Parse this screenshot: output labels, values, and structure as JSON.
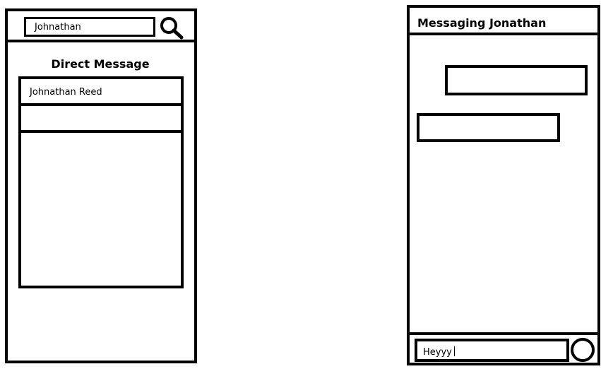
{
  "search": {
    "value": "Johnathan"
  },
  "direct_message": {
    "title": "Direct Message",
    "results": [
      {
        "label": "Johnathan Reed"
      },
      {
        "label": ""
      }
    ]
  },
  "chat": {
    "title": "Messaging Jonathan",
    "messages": [
      {
        "text": ""
      },
      {
        "text": ""
      }
    ],
    "compose_value": "Heyyy"
  },
  "icons": {
    "search": "search-icon",
    "send": "send-icon"
  },
  "colors": {
    "outline": "#000000",
    "background": "#ffffff"
  }
}
